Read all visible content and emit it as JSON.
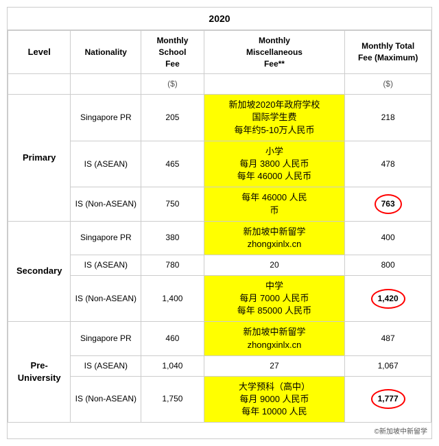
{
  "title": "2020",
  "headers": {
    "level": "Level",
    "nationality": "Nationality",
    "school_fee": "Monthly School Fee",
    "misc_fee": "Monthly Miscellaneous Fee**",
    "total_fee": "Monthly Total Fee (Maximum)"
  },
  "unit_row": {
    "school_fee_unit": "($)",
    "total_fee_unit": "($)"
  },
  "rows": [
    {
      "level": "Primary",
      "level_rowspan": 3,
      "nationality": "Singapore PR",
      "school_fee": "205",
      "misc_fee_yellow": true,
      "misc_fee_note": "新加坡2020年政府学校\n国际学生费\n每年约5-10万人民币",
      "total_fee": "218",
      "total_circled": false
    },
    {
      "level": "",
      "nationality": "IS (ASEAN)",
      "school_fee": "465",
      "misc_fee_yellow": true,
      "misc_fee_note": "小学\n每月 3800 人民币\n每年 46000 人民币",
      "total_fee": "478",
      "total_circled": false
    },
    {
      "level": "",
      "nationality": "IS (Non-ASEAN)",
      "school_fee": "750",
      "misc_fee_yellow": true,
      "misc_fee_note": "每年 46000 人民\n币",
      "total_fee": "763",
      "total_circled": true
    },
    {
      "level": "Secondary",
      "level_rowspan": 3,
      "nationality": "Singapore PR",
      "school_fee": "380",
      "misc_fee_yellow": true,
      "misc_fee_note": "新加坡中新留学\nzhongxinlx.cn",
      "total_fee": "400",
      "total_circled": false
    },
    {
      "level": "",
      "nationality": "IS (ASEAN)",
      "school_fee": "780",
      "misc_fee_yellow": false,
      "misc_fee_note": "20",
      "total_fee": "800",
      "total_circled": false
    },
    {
      "level": "",
      "nationality": "IS (Non-ASEAN)",
      "school_fee": "1,400",
      "misc_fee_yellow": true,
      "misc_fee_note": "中学\n每月 7000 人民币\n每年 85000 人民币",
      "total_fee": "1,420",
      "total_circled": true
    },
    {
      "level": "Pre-University",
      "level_rowspan": 3,
      "nationality": "Singapore PR",
      "school_fee": "460",
      "misc_fee_yellow": true,
      "misc_fee_note": "新加坡中新留学\nzhongxinlx.cn",
      "total_fee": "487",
      "total_circled": false
    },
    {
      "level": "",
      "nationality": "IS (ASEAN)",
      "school_fee": "1,040",
      "misc_fee_yellow": false,
      "misc_fee_note": "27",
      "total_fee": "1,067",
      "total_circled": false
    },
    {
      "level": "",
      "nationality": "IS (Non-ASEAN)",
      "school_fee": "1,750",
      "misc_fee_yellow": true,
      "misc_fee_note": "大学预科（高中）\n每月 9000 人民币\n每年 10000 人民",
      "total_fee": "1,777",
      "total_circled": true
    }
  ],
  "bottom_note": "©新加坡中新留学"
}
